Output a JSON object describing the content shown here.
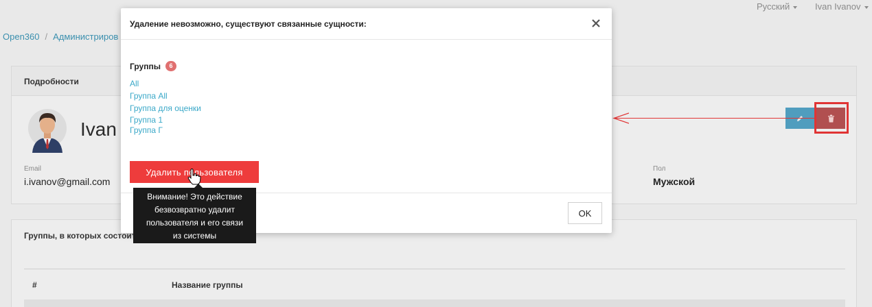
{
  "header": {
    "language": "Русский",
    "user_name": "Ivan Ivanov"
  },
  "breadcrumbs": [
    "Open360",
    "Администриров"
  ],
  "details": {
    "title": "Подробности",
    "name": "Ivan",
    "email_label": "Email",
    "email": "i.ivanov@gmail.com",
    "sex_label": "Пол",
    "sex": "Мужской"
  },
  "groups_card": {
    "title": "Группы, в которых состоит",
    "col_num": "#",
    "col_name": "Название группы"
  },
  "modal": {
    "title": "Удаление невозможно, существуют связанные сущности:",
    "section_label": "Группы",
    "count": "6",
    "groups": [
      "All",
      "Группа All",
      "Группа для оценки",
      "Группа 1",
      "Группа Г"
    ],
    "delete_button": "Удалить пользователя",
    "ok_button": "OK",
    "tooltip_lines": [
      "Внимание! Это действие",
      "безвозвратно удалит",
      "пользователя и его связи",
      "из системы"
    ]
  },
  "colors": {
    "accent": "#3aa8c8",
    "danger": "#ee3c3c",
    "highlight": "#e03434"
  },
  "icons": {
    "close": "close-icon",
    "edit": "pencil-icon",
    "delete": "trash-icon",
    "cursor": "hand-cursor-icon"
  }
}
